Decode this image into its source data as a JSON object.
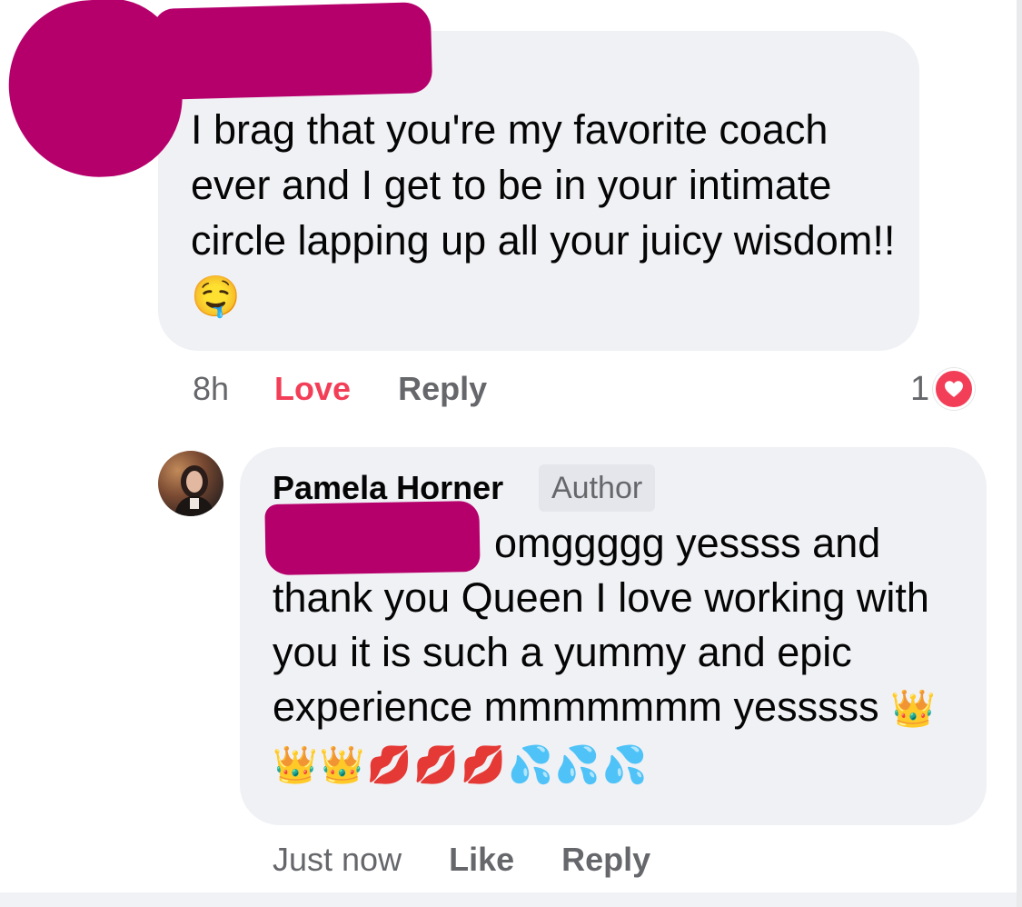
{
  "comment1": {
    "text": "I brag that you're my favorite coach ever and I get to be in your intimate circle lapping up all your juicy wisdom!!",
    "emoji": "🤤",
    "time": "8h",
    "love_label": "Love",
    "reply_label": "Reply",
    "reaction_count": "1",
    "reaction_icon": "heart-icon"
  },
  "comment2": {
    "author": "Pamela Horner",
    "badge": "Author",
    "text": "omggggg yessss and thank you Queen I love working with you it is such a yummy and epic experience mmmmmmm yesssss",
    "emojis": "👑👑👑💋💋💋💦💦💦",
    "time": "Just now",
    "like_label": "Like",
    "reply_label": "Reply"
  },
  "colors": {
    "bubble": "#f0f1f5",
    "love": "#f33e58",
    "redaction": "#b5006c",
    "meta_text": "#65676b"
  }
}
